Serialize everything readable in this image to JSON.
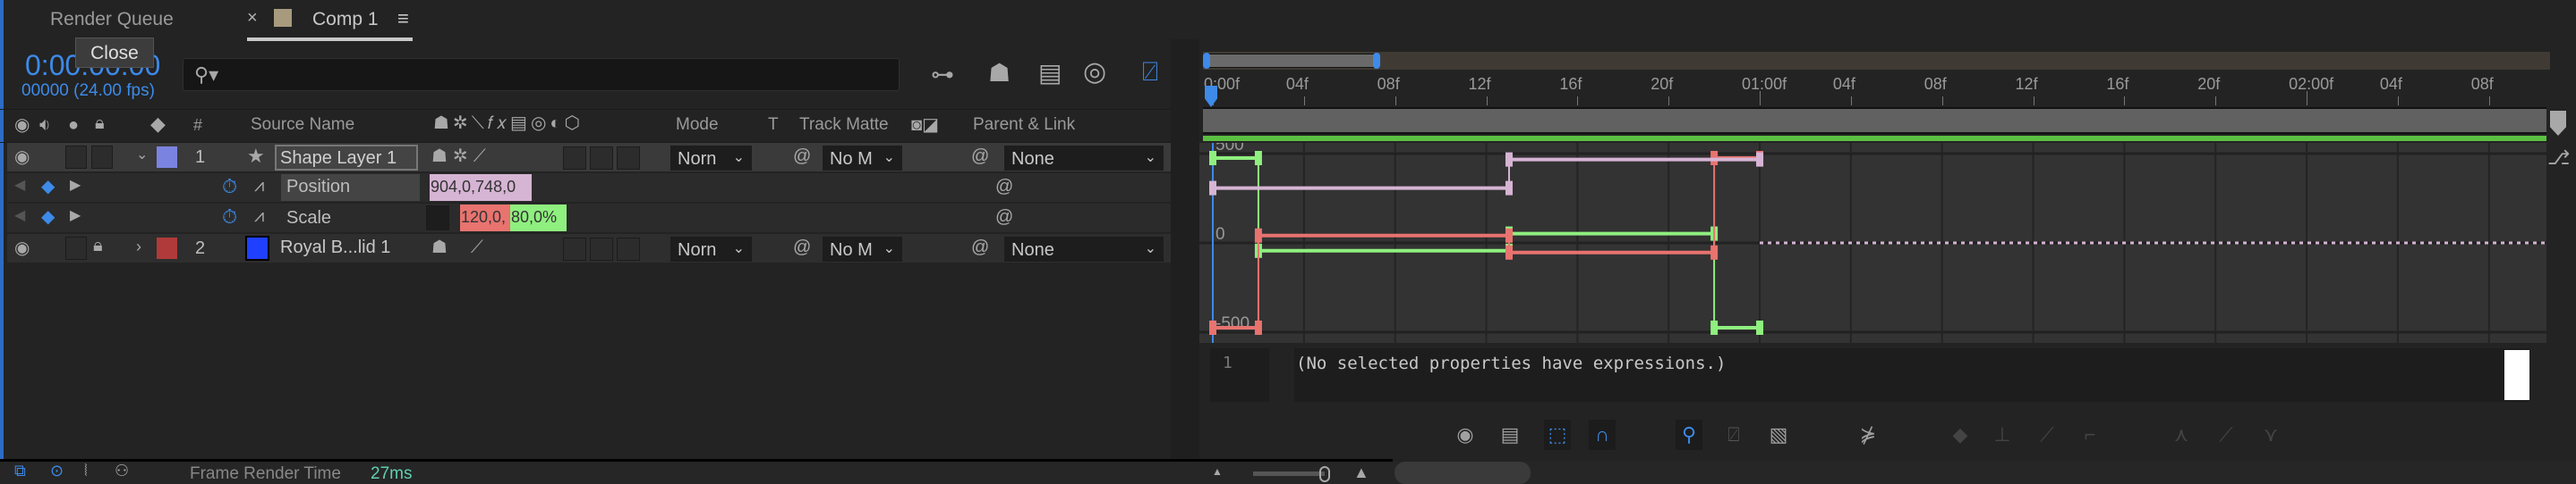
{
  "tabs": {
    "render_queue": "Render Queue",
    "comp": "Comp 1",
    "close_tooltip": "Close",
    "close_x": "×",
    "menu": "≡"
  },
  "time": {
    "timecode": "0:00:00:00",
    "frames": "00000 (24.00 fps)"
  },
  "search": {
    "placeholder": ""
  },
  "columns": {
    "source_name": "Source Name",
    "number": "#",
    "mode": "Mode",
    "t": "T",
    "track_matte": "Track Matte",
    "parent_link": "Parent & Link"
  },
  "layers": [
    {
      "index": "1",
      "name": "Shape Layer 1",
      "mode": "Norn",
      "track_matte": "No M",
      "parent": "None",
      "label_color": "#7b83e0"
    },
    {
      "index": "2",
      "name": "Royal B...lid 1",
      "mode": "Norn",
      "track_matte": "No M",
      "parent": "None",
      "label_color": "#b03a3a",
      "swatch": "#2040ff"
    }
  ],
  "properties": [
    {
      "name": "Position",
      "value": "904,0,748,0",
      "color": "#d6b4d4"
    },
    {
      "name": "Scale",
      "value_x": "120,0,",
      "value_y": "80,0%",
      "color_x": "#e8736f",
      "color_y": "#8fef7f"
    }
  ],
  "ruler": {
    "labels": [
      "0:00f",
      "04f",
      "08f",
      "12f",
      "16f",
      "20f",
      "01:00f",
      "04f",
      "08f",
      "12f",
      "16f",
      "20f",
      "02:00f",
      "04f",
      "08f"
    ]
  },
  "graph": {
    "value_labels": [
      "500",
      "0",
      "-500"
    ],
    "series": [
      {
        "name": "scale-y",
        "color": "#8fef7f",
        "segments": [
          [
            0,
            2,
            475
          ],
          [
            2,
            13,
            -44
          ],
          [
            13,
            22,
            52
          ],
          [
            22,
            24,
            -475
          ]
        ]
      },
      {
        "name": "scale-x",
        "color": "#e8736f",
        "segments": [
          [
            0,
            2,
            -475
          ],
          [
            2,
            13,
            41
          ],
          [
            13,
            22,
            -54
          ],
          [
            22,
            24,
            475
          ]
        ]
      },
      {
        "name": "position",
        "color": "#d6b4d4",
        "segments": [
          [
            0,
            13,
            307
          ],
          [
            13,
            24,
            467
          ]
        ]
      }
    ]
  },
  "expression": {
    "line": "1",
    "text": "(No selected properties have expressions.)"
  },
  "status": {
    "label": "Frame Render Time",
    "value": "27ms"
  }
}
